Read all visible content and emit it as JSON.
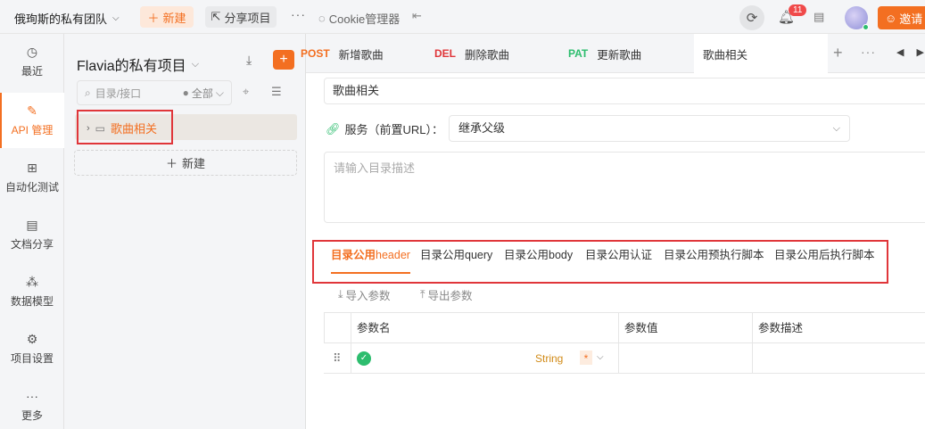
{
  "topbar": {
    "team_name": "俄珣斯的私有团队",
    "new_label": "新建",
    "share_label": "分享项目",
    "more": "···",
    "cookie_label": "Cookie管理器",
    "notif_count": "11",
    "invite_label": "邀请"
  },
  "leftnav": {
    "items": [
      {
        "label": "最近",
        "icon": "clock-icon"
      },
      {
        "label": "API 管理",
        "icon": "api-icon"
      },
      {
        "label": "自动化测试",
        "icon": "automation-icon"
      },
      {
        "label": "文档分享",
        "icon": "doc-share-icon"
      },
      {
        "label": "数据模型",
        "icon": "data-model-icon"
      },
      {
        "label": "项目设置",
        "icon": "settings-icon"
      },
      {
        "label": "更多",
        "icon": "more-icon"
      }
    ]
  },
  "project": {
    "title": "Flavia的私有项目",
    "search_placeholder": "目录/接口",
    "filter_label": "全部",
    "folder_name": "歌曲相关",
    "new_label": "新建"
  },
  "tabs": [
    {
      "method": "POST",
      "label": "新增歌曲",
      "method_color": "#f36f21"
    },
    {
      "method": "DEL",
      "label": "删除歌曲",
      "method_color": "#e0363a"
    },
    {
      "method": "PAT",
      "label": "更新歌曲",
      "method_color": "#2dbd6e"
    },
    {
      "method": "",
      "label": "歌曲相关"
    }
  ],
  "form": {
    "name_value": "歌曲相关",
    "service_label": "服务（前置URL）：",
    "service_value": "继承父级",
    "desc_placeholder": "请输入目录描述"
  },
  "subtabs": [
    {
      "prefix": "目录公用",
      "suffix": "header"
    },
    {
      "prefix": "目录公用",
      "suffix": "query"
    },
    {
      "prefix": "目录公用",
      "suffix": "body"
    },
    {
      "prefix": "目录公用认证",
      "suffix": ""
    },
    {
      "prefix": "目录公用预执行脚本",
      "suffix": ""
    },
    {
      "prefix": "目录公用后执行脚本",
      "suffix": ""
    }
  ],
  "toolbar": {
    "import_label": "导入参数",
    "export_label": "导出参数"
  },
  "params_table": {
    "columns": [
      "参数名",
      "参数值",
      "参数描述"
    ],
    "row": {
      "type": "String",
      "required": "*"
    }
  }
}
